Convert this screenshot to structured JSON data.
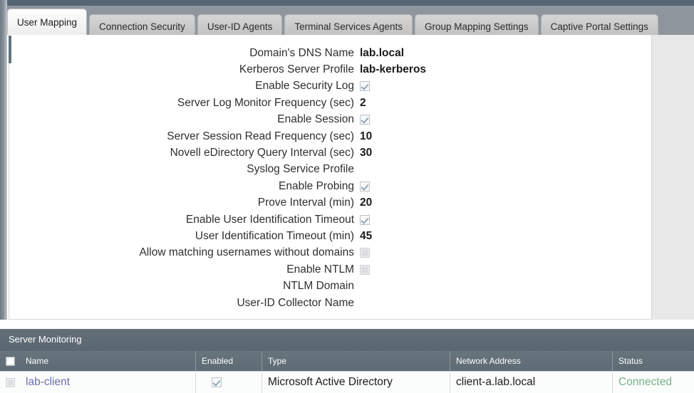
{
  "tabs": [
    {
      "label": "User Mapping",
      "active": true
    },
    {
      "label": "Connection Security",
      "active": false
    },
    {
      "label": "User-ID Agents",
      "active": false
    },
    {
      "label": "Terminal Services Agents",
      "active": false
    },
    {
      "label": "Group Mapping Settings",
      "active": false
    },
    {
      "label": "Captive Portal Settings",
      "active": false
    }
  ],
  "form": {
    "rows": [
      {
        "label": "Domain's DNS Name",
        "type": "text",
        "value": "lab.local"
      },
      {
        "label": "Kerberos Server Profile",
        "type": "text",
        "value": "lab-kerberos"
      },
      {
        "label": "Enable Security Log",
        "type": "checkbox",
        "value": "checked"
      },
      {
        "label": "Server Log Monitor Frequency (sec)",
        "type": "text",
        "value": "2"
      },
      {
        "label": "Enable Session",
        "type": "checkbox",
        "value": "checked"
      },
      {
        "label": "Server Session Read Frequency (sec)",
        "type": "text",
        "value": "10"
      },
      {
        "label": "Novell eDirectory Query Interval (sec)",
        "type": "text",
        "value": "30"
      },
      {
        "label": "Syslog Service Profile",
        "type": "text",
        "value": ""
      },
      {
        "label": "Enable Probing",
        "type": "checkbox",
        "value": "checked"
      },
      {
        "label": "Prove Interval (min)",
        "type": "text",
        "value": "20"
      },
      {
        "label": "Enable User Identification Timeout",
        "type": "checkbox",
        "value": "checked"
      },
      {
        "label": "User Identification Timeout (min)",
        "type": "text",
        "value": "45"
      },
      {
        "label": "Allow matching usernames without domains",
        "type": "checkbox",
        "value": "unchecked"
      },
      {
        "label": "Enable NTLM",
        "type": "checkbox",
        "value": "unchecked"
      },
      {
        "label": "NTLM Domain",
        "type": "text",
        "value": ""
      },
      {
        "label": "User-ID Collector Name",
        "type": "text",
        "value": ""
      }
    ]
  },
  "server_monitoring": {
    "title": "Server Monitoring",
    "columns": [
      "Name",
      "Enabled",
      "Type",
      "Network Address",
      "Status"
    ],
    "rows": [
      {
        "selected": "unchecked",
        "name": "lab-client",
        "enabled": "checked",
        "type": "Microsoft Active Directory",
        "network_address": "client-a.lab.local",
        "status": "Connected"
      }
    ]
  },
  "colors": {
    "chrome": "#566573",
    "tabstrip": "#8e959c",
    "section_header": "#5e6b74",
    "link": "#6a6fb0",
    "status_connected": "#77b388",
    "check_mark": "#94a8b5"
  }
}
